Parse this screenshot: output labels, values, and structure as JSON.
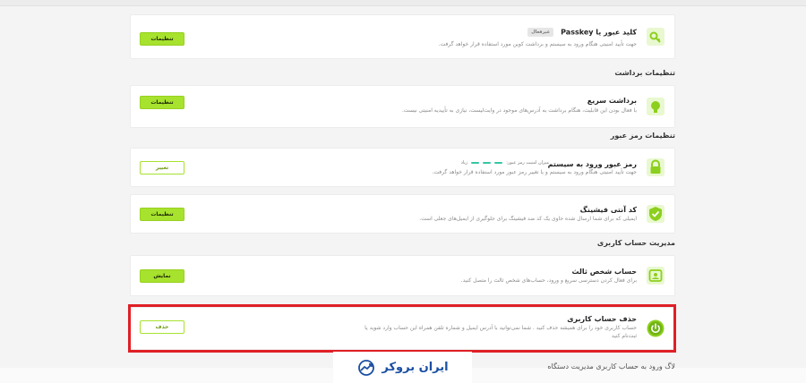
{
  "colors": {
    "accent": "#a7e22e",
    "danger": "#e01f26",
    "brand": "#1a4fa3"
  },
  "passkey": {
    "title": "کلید عبور یا Passkey",
    "badge": "غیرفعال",
    "desc": "جهت تأیید امنیتی هنگام ورود به سیستم و برداشت کوین مورد استفاده قرار خواهد گرفت.",
    "button": "تنظیمات",
    "icon": "key-icon"
  },
  "sections": {
    "withdraw": "تنظیمات برداشت",
    "password": "تنظیمات رمز عبور",
    "account": "مدیریت حساب کاربری"
  },
  "quick_withdraw": {
    "title": "برداشت سریع",
    "desc": "با فعال بودن این قابلیت، هنگام برداشت به آدرس‌های موجود در وایت‌لیست، نیازی به تأییدیه امنیتی نیست.",
    "button": "تنظیمات",
    "icon": "lightning-icon"
  },
  "login_password": {
    "title": "رمز عبور ورود به سیستم",
    "strength_label": "میزان امنیت رمز عبور:",
    "strength_value": "زیاد",
    "desc": "جهت تأیید امنیتی هنگام ورود به سیستم و یا تغییر رمز عبور مورد استفاده قرار خواهد گرفت.",
    "button": "تغییر",
    "icon": "lock-icon"
  },
  "anti_phishing": {
    "title": "کد آنتی فیشینگ",
    "desc": "ایمیلی که برای شما ارسال شده حاوی یک کد ضد فیشینگ برای جلوگیری از ایمیل‌های جعلی است.",
    "button": "تنظیمات",
    "icon": "shield-check-icon"
  },
  "third_party": {
    "title": "حساب شخص ثالث",
    "desc": "برای فعال کردن دسترسی سریع و ورود، حساب‌های شخص ثالث را متصل کنید.",
    "button": "نمایش",
    "icon": "third-party-icon"
  },
  "delete_account": {
    "title": "حذف حساب کاربری",
    "desc_line1": "حساب کاربری خود را برای همیشه حذف کنید . شما نمی‌توانید با آدرس ایمیل و شماره تلفن همراه این حساب وارد شوید یا",
    "desc_line2": "ثبت‌نام کنید",
    "button": "حذف",
    "icon": "power-icon"
  },
  "bottom_peek": "لاگ ورود به حساب کاربری       مدیریت دستگاه",
  "logo": {
    "text": "ایران بروکر",
    "icon": "chart-arrow-icon"
  }
}
